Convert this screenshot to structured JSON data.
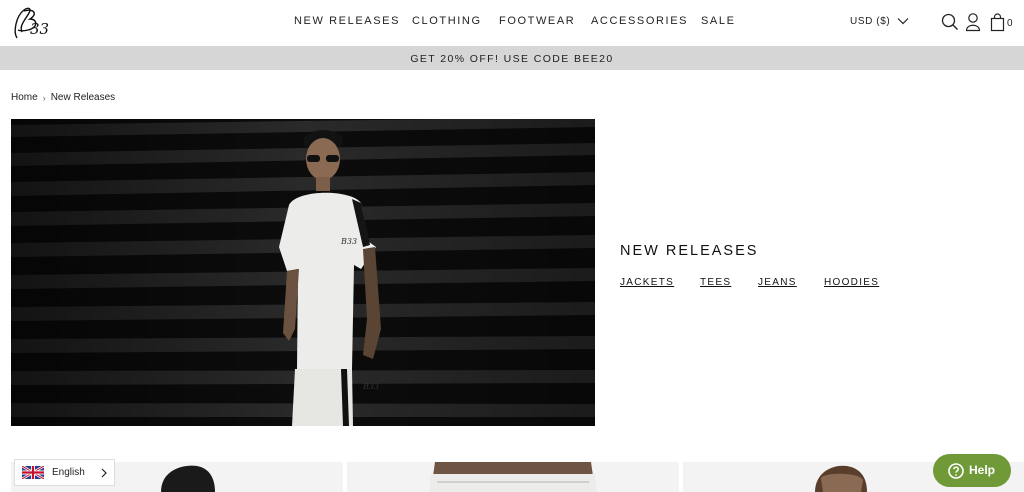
{
  "header": {
    "logo_text": "B33",
    "nav": [
      "NEW RELEASES",
      "CLOTHING",
      "FOOTWEAR",
      "ACCESSORIES",
      "SALE"
    ],
    "currency": "USD ($)",
    "cart_count": "0",
    "icons": [
      "search-icon",
      "account-icon",
      "bag-icon",
      "chevron-down-icon"
    ]
  },
  "promo": {
    "text": "GET 20% OFF! USE CODE BEE20"
  },
  "breadcrumb": {
    "home": "Home",
    "separator": "›",
    "current": "New Releases"
  },
  "hero": {
    "title": "NEW RELEASES",
    "links": [
      "JACKETS",
      "TEES",
      "JEANS",
      "HOODIES"
    ]
  },
  "language": {
    "label": "English"
  },
  "help": {
    "label": "Help"
  },
  "colors": {
    "promo_bg": "#d6d6d6",
    "help_green": "#6f9a37",
    "text": "#111111"
  }
}
